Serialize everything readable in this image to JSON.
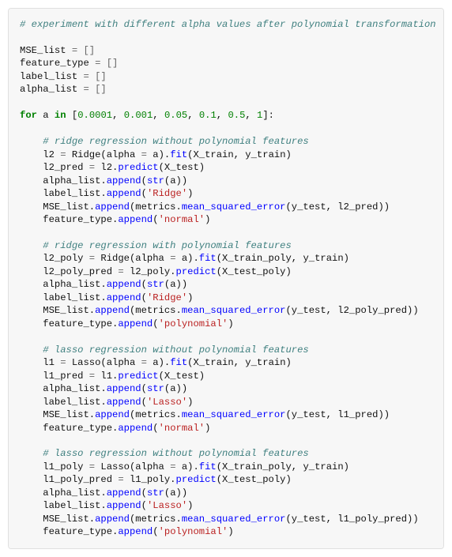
{
  "code": {
    "c_top": "# experiment with different alpha values after polynomial transformation",
    "init": {
      "mse": "MSE_list",
      "feat": "feature_type",
      "lab": "label_list",
      "alp": "alpha_list",
      "eq": " = []"
    },
    "forline": {
      "for": "for",
      "a": " a ",
      "in": "in",
      "sp": " [",
      "v1": "0.0001",
      "v2": "0.001",
      "v3": "0.05",
      "v4": "0.1",
      "v5": "0.5",
      "v6": "1",
      "comma": ", ",
      "close": "]:"
    },
    "sec1": {
      "comment": "# ridge regression without polynomial features",
      "a1": "l2 ",
      "eq": "= ",
      "ridge": "Ridge(alpha ",
      "eq2": "= ",
      "av": "a).",
      "fit": "fit",
      "fitargs": "(X_train, y_train)",
      "b1": "l2_pred ",
      "l2p": "l2.",
      "pred": "predict",
      "predargs": "(X_test)",
      "c1": "alpha_list.",
      "append": "append",
      "strcall": "(",
      "strfn": "str",
      "strarg": "(a))",
      "d1": "label_list.",
      "ridgestr": "'Ridge'",
      "e1": "MSE_list.",
      "metrics": "(metrics.",
      "msefn": "mean_squared_error",
      "mseargs": "(y_test, l2_pred))",
      "f1": "feature_type.",
      "normstr": "'normal'",
      "close": ")"
    },
    "sec2": {
      "comment": "# ridge regression with polynomial features",
      "a1": "l2_poly ",
      "fitargs": "(X_train_poly, y_train)",
      "b1": "l2_poly_pred ",
      "l2p": "l2_poly.",
      "predargs": "(X_test_poly)",
      "mseargs": "(y_test, l2_poly_pred))",
      "polystr": "'polynomial'"
    },
    "sec3": {
      "comment": "# lasso regression without polynomial features",
      "a1": "l1 ",
      "lasso": "Lasso(alpha ",
      "b1": "l1_pred ",
      "l1p": "l1.",
      "mseargs": "(y_test, l1_pred))",
      "lassostr": "'Lasso'"
    },
    "sec4": {
      "comment": "# lasso regression without polynomial features",
      "a1": "l1_poly ",
      "b1": "l1_poly_pred ",
      "l1p": "l1_poly.",
      "predargs": "(X_test_poly)",
      "fitargs": "(X_train_poly, y_train)",
      "mseargs": "(y_test, l1_poly_pred))"
    }
  }
}
